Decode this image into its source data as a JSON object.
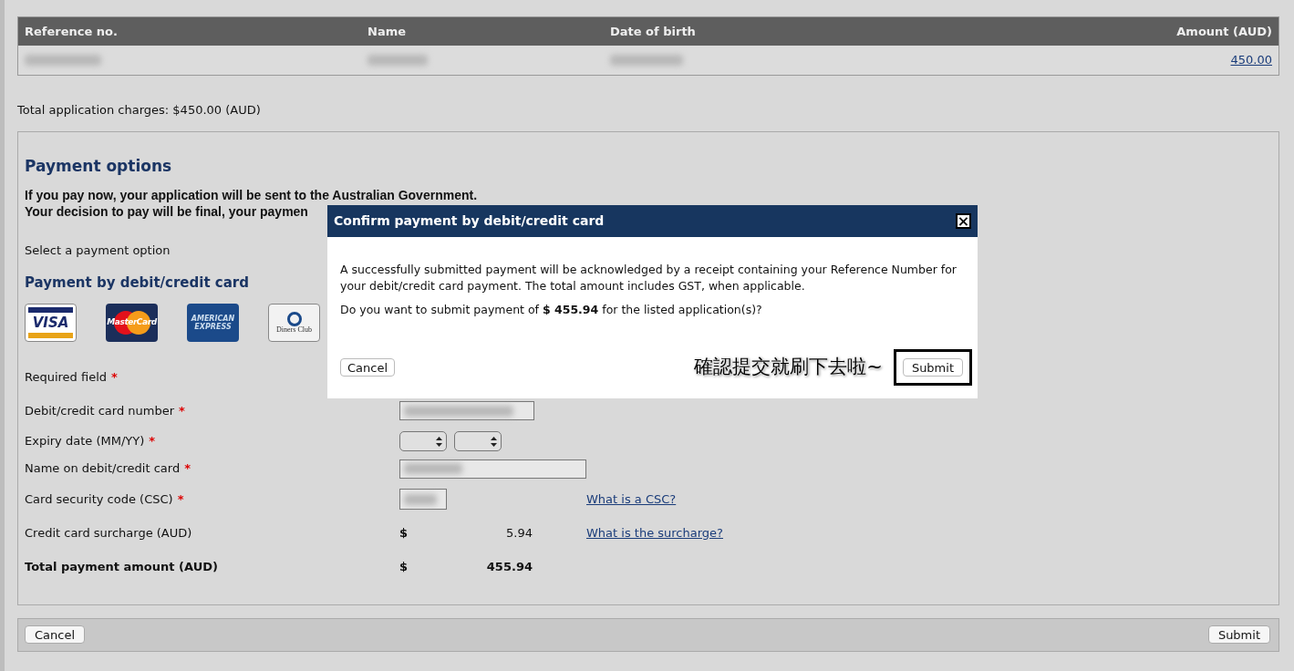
{
  "table": {
    "columns": [
      "Reference no.",
      "Name",
      "Date of birth",
      "Amount (AUD)"
    ],
    "rows": [
      {
        "amount": "450.00"
      }
    ]
  },
  "total_charges": "Total application charges: $450.00 (AUD)",
  "payment": {
    "title": "Payment options",
    "warning": [
      "If you pay now, your application will be sent to the Australian Government.",
      "Your decision to pay will be final, your paymen"
    ],
    "select_label": "Select a payment option",
    "card_heading": "Payment by debit/credit card",
    "cards": [
      {
        "kind": "visa",
        "label": "VISA"
      },
      {
        "kind": "mastercard",
        "label": "MasterCard"
      },
      {
        "kind": "amex",
        "label": "AMERICAN EXPRESS"
      },
      {
        "kind": "diners",
        "label": "Diners Club"
      }
    ],
    "required_mark": "*",
    "rows": [
      {
        "kind": "note",
        "label": "Required field",
        "required": true
      },
      {
        "kind": "card_number",
        "label": "Debit/credit card number",
        "required": true
      },
      {
        "kind": "expiry",
        "label": "Expiry date (MM/YY)",
        "required": true
      },
      {
        "kind": "name",
        "label": "Name on debit/credit card",
        "required": true
      },
      {
        "kind": "csc",
        "label": "Card security code (CSC)",
        "required": true,
        "link": "What is a CSC?"
      },
      {
        "kind": "surcharge",
        "label": "Credit card surcharge (AUD)",
        "required": false,
        "currency": "$",
        "amount": "5.94",
        "link": "What is the surcharge?"
      },
      {
        "kind": "total",
        "label": "Total payment amount (AUD)",
        "required": false,
        "currency": "$",
        "amount": "455.94"
      }
    ]
  },
  "footer": {
    "cancel": "Cancel",
    "submit": "Submit"
  },
  "dialog": {
    "title": "Confirm payment by debit/credit card",
    "close": "×",
    "message": "A successfully submitted payment will be acknowledged by a receipt containing your Reference Number for your debit/credit card payment. The total amount includes GST, when applicable.",
    "question": "Do you want to submit payment of **$ 455.94** for the listed application(s)?",
    "cancel": "Cancel",
    "submit": "Submit",
    "annotation": "確認提交就刷下去啦~"
  }
}
